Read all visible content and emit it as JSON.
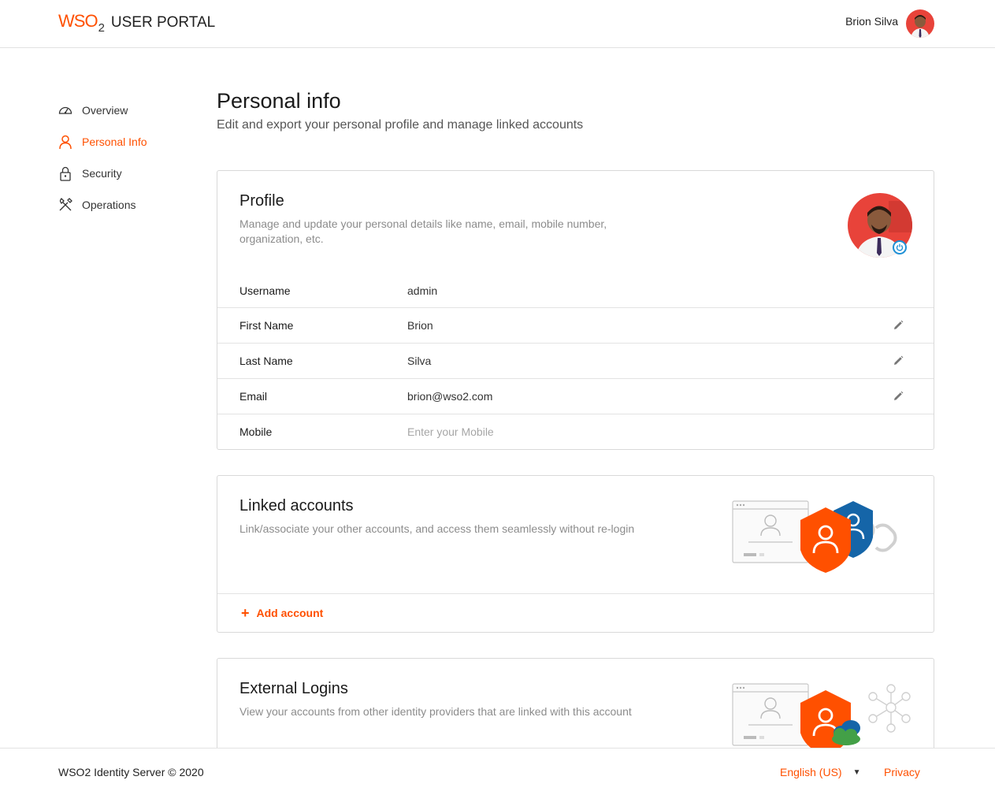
{
  "header": {
    "logo_text": "WSO",
    "logo_sub": "2",
    "app_title": "USER PORTAL",
    "user_name": "Brion Silva"
  },
  "sidebar": {
    "items": [
      {
        "label": "Overview",
        "icon": "dashboard-icon",
        "active": false
      },
      {
        "label": "Personal Info",
        "icon": "user-icon",
        "active": true
      },
      {
        "label": "Security",
        "icon": "lock-icon",
        "active": false
      },
      {
        "label": "Operations",
        "icon": "tools-icon",
        "active": false
      }
    ]
  },
  "page": {
    "title": "Personal info",
    "subtitle": "Edit and export your personal profile and manage linked accounts"
  },
  "profile": {
    "title": "Profile",
    "description": "Manage and update your personal details like name, email, mobile number, organization, etc.",
    "fields": [
      {
        "label": "Username",
        "value": "admin",
        "editable": false
      },
      {
        "label": "First Name",
        "value": "Brion",
        "editable": true
      },
      {
        "label": "Last Name",
        "value": "Silva",
        "editable": true
      },
      {
        "label": "Email",
        "value": "brion@wso2.com",
        "editable": true
      },
      {
        "label": "Mobile",
        "placeholder": "Enter your Mobile",
        "editable": false
      }
    ]
  },
  "linked_accounts": {
    "title": "Linked accounts",
    "description": "Link/associate your other accounts, and access them seamlessly without re-login",
    "add_label": "Add account"
  },
  "external_logins": {
    "title": "External Logins",
    "description": "View your accounts from other identity providers that are linked with this account"
  },
  "footer": {
    "copyright": "WSO2 Identity Server © 2020",
    "language": "English (US)",
    "privacy": "Privacy"
  },
  "colors": {
    "accent": "#ff5000",
    "shield_blue": "#1565a8",
    "cloud_green": "#43a047"
  }
}
